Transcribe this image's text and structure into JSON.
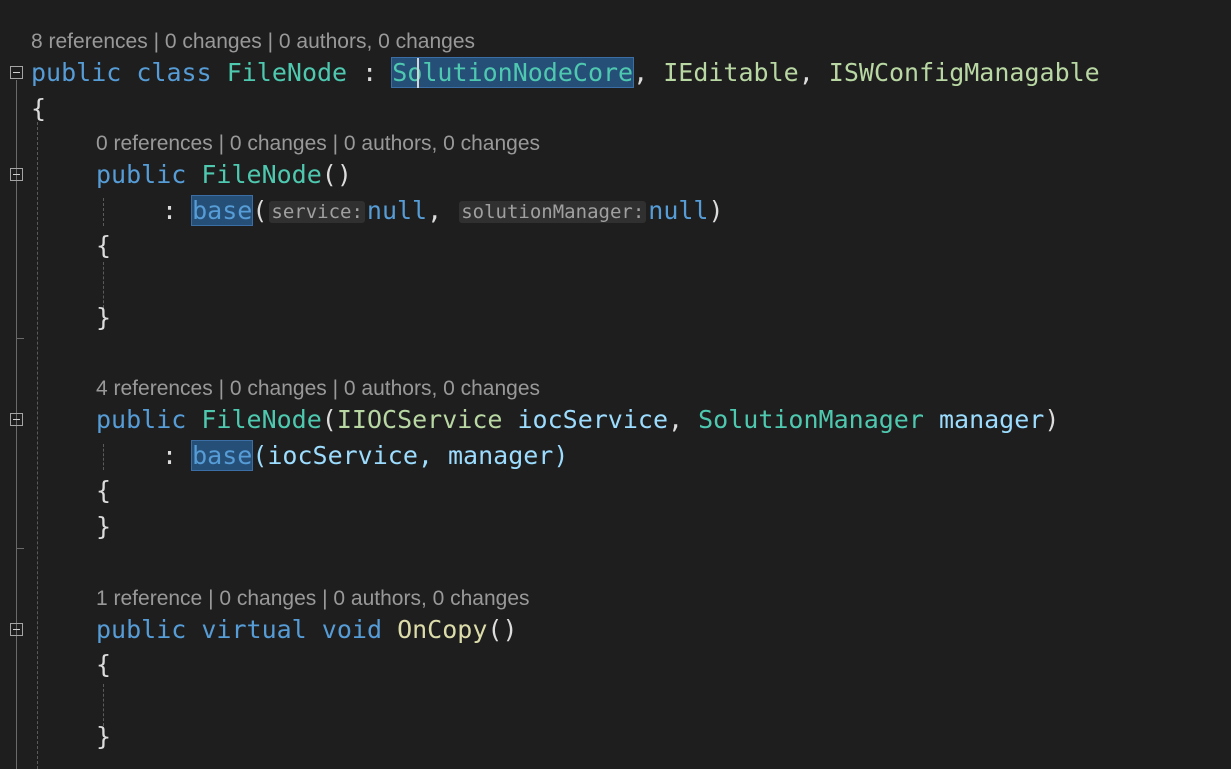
{
  "code_lens": {
    "class_lens": "8 references | 0 changes | 0 authors, 0 changes",
    "ctor1_lens": "0 references | 0 changes | 0 authors, 0 changes",
    "ctor2_lens": "4 references | 0 changes | 0 authors, 0 changes",
    "method_lens": "1 reference | 0 changes | 0 authors, 0 changes"
  },
  "line1": {
    "public": "public",
    "class": "class",
    "class_name": "FileNode",
    "colon": " : ",
    "base_type": "SolutionNodeCore",
    "comma1": ", ",
    "iface1": "IEditable",
    "comma2": ", ",
    "iface2": "ISWConfigManagable"
  },
  "brace_open": "{",
  "brace_close": "}",
  "ctor1": {
    "public": "public",
    "name": "FileNode",
    "parens": "()",
    "colon": ": ",
    "base": "base",
    "open_paren": "(",
    "hint_service": "service:",
    "null1": "null",
    "comma": ", ",
    "hint_manager": "solutionManager:",
    "null2": "null",
    "close_paren": ")"
  },
  "ctor2": {
    "public": "public",
    "name": "FileNode",
    "open_paren": "(",
    "type1": "IIOCService",
    "param1": "iocService",
    "comma": ", ",
    "type2": "SolutionManager",
    "param2": "manager",
    "close_paren": ")",
    "colon": ": ",
    "base": "base",
    "args": "(iocService, manager)"
  },
  "method": {
    "public": "public",
    "virtual": "virtual",
    "void": "void",
    "name": "OnCopy",
    "parens": "()"
  },
  "colors": {
    "background": "#1e1e1e",
    "keyword": "#569cd6",
    "type": "#4ec9b0",
    "interface": "#b8d7a3",
    "method": "#dcdcaa",
    "parameter": "#9cdcfe",
    "selection": "#264f78"
  }
}
